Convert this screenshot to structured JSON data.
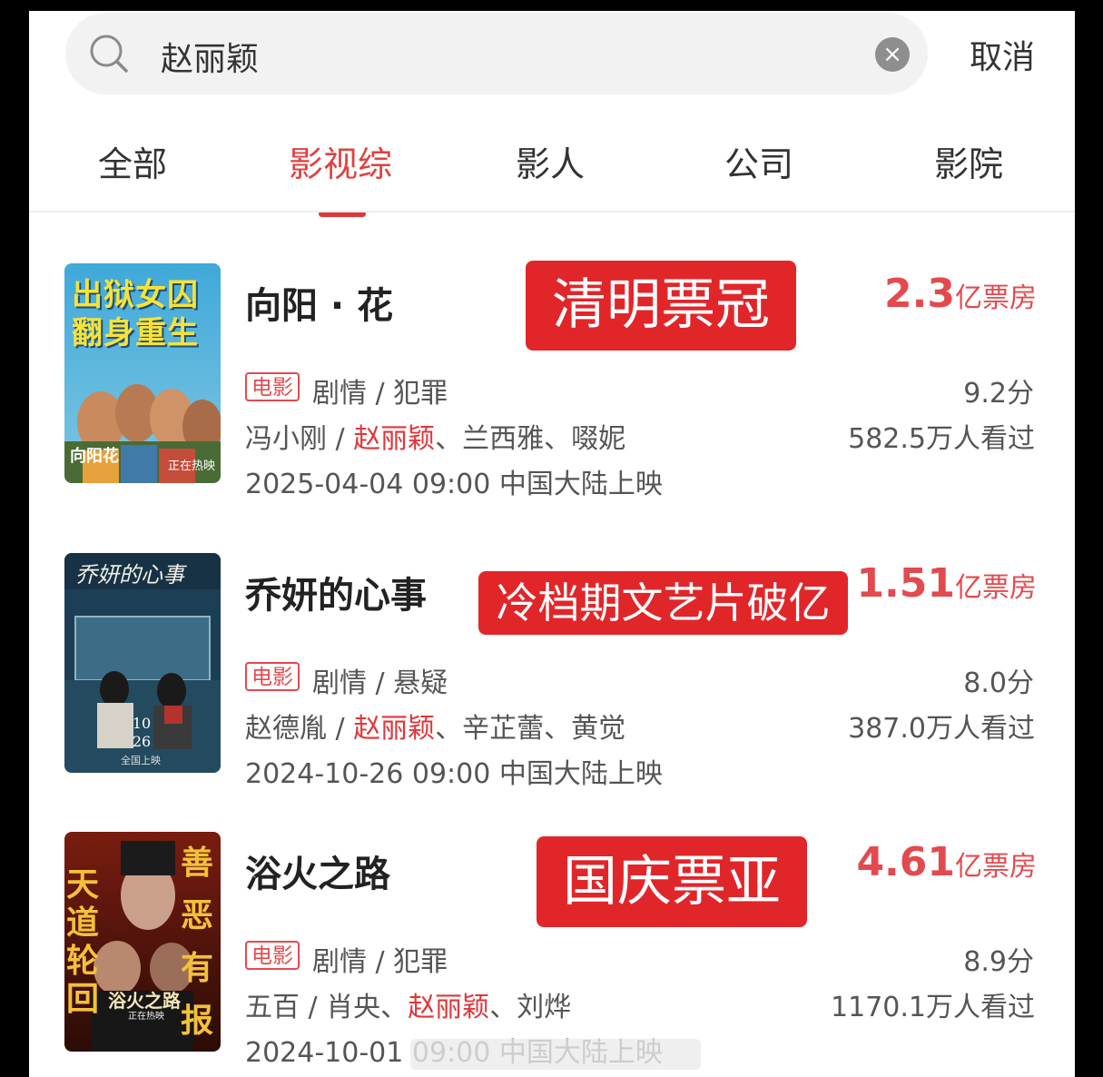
{
  "search": {
    "query": "赵丽颖",
    "cancel_label": "取消"
  },
  "tabs": [
    {
      "label": "全部",
      "active": false
    },
    {
      "label": "影视综",
      "active": true
    },
    {
      "label": "影人",
      "active": false
    },
    {
      "label": "公司",
      "active": false
    },
    {
      "label": "影院",
      "active": false
    }
  ],
  "accent_color": "#e0363a",
  "results": [
    {
      "title": "向阳 · 花",
      "type_tag": "电影",
      "genre": "剧情 / 犯罪",
      "director": "冯小刚",
      "cast_highlight": "赵丽颖",
      "cast_rest": "、兰西雅、啜妮",
      "release": "2025-04-04 09:00 中国大陆上映",
      "box_office_value": "2.3",
      "box_office_unit": "亿票房",
      "score": "9.2分",
      "views": "582.5万人看过",
      "overlay": "清明票冠",
      "poster_text_main": "出狱女囚 翻身重生",
      "poster_badge": "正在热映",
      "poster_logo": "向阳花"
    },
    {
      "title": "乔妍的心事",
      "type_tag": "电影",
      "genre": "剧情 / 悬疑",
      "director": "赵德胤",
      "cast_highlight": "赵丽颖",
      "cast_rest": "、辛芷蕾、黄觉",
      "release": "2024-10-26 09:00 中国大陆上映",
      "box_office_value": "1.51",
      "box_office_unit": "亿票房",
      "score": "8.0分",
      "views": "387.0万人看过",
      "overlay": "冷档期文艺片破亿",
      "poster_title": "乔妍的心事",
      "poster_date": "10 26",
      "poster_sub": "全国上映"
    },
    {
      "title": "浴火之路",
      "type_tag": "电影",
      "genre": "剧情 / 犯罪",
      "director": "五百",
      "cast_pre": "肖央、",
      "cast_highlight": "赵丽颖",
      "cast_rest": "、刘烨",
      "release": "2024-10-01 09:00 中国大陆上映",
      "box_office_value": "4.61",
      "box_office_unit": "亿票房",
      "score": "8.9分",
      "views": "1170.1万人看过",
      "overlay": "国庆票亚",
      "poster_left": "天道轮回",
      "poster_right": "善恶有报",
      "poster_logo": "浴火之路",
      "poster_badge": "正在热映"
    }
  ]
}
